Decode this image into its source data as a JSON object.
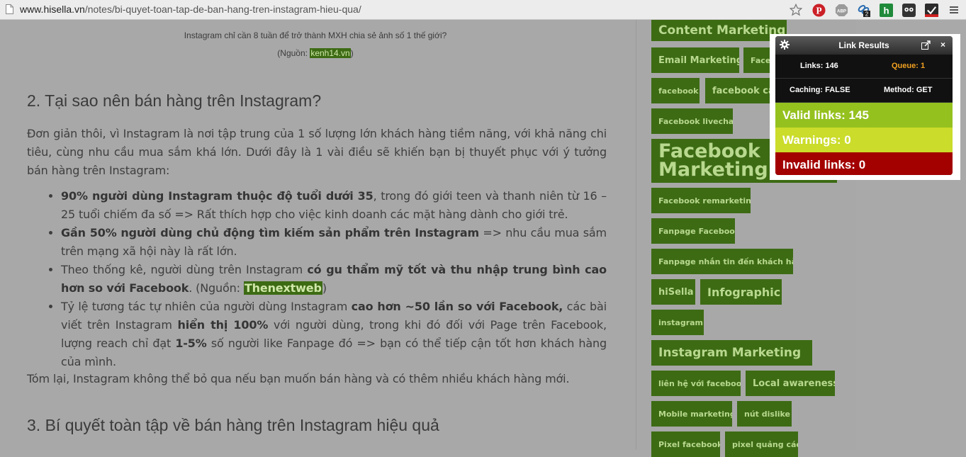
{
  "browser": {
    "url_host": "www.hisella.vn",
    "url_path": "/notes/bi-quyet-toan-tap-de-ban-hang-tren-instagram-hieu-qua/",
    "extensions": [
      "star-icon",
      "pinterest-icon",
      "adblock-icon",
      "link-checker-icon",
      "h-extension-icon",
      "owl-icon",
      "checkmark-icon",
      "menu-icon"
    ],
    "link_badge": "2"
  },
  "article": {
    "caption_line1": "Instagram chỉ cần 8 tuần để trở thành MXH chia sẻ ảnh số 1 thế giới?",
    "caption_source_prefix": "(Nguồn: ",
    "caption_source_link": "kenh14.vn",
    "caption_source_suffix": ")",
    "heading2": "2. Tại sao nên bán hàng trên Instagram?",
    "intro": "Đơn giản thôi, vì Instagram là nơi tập trung của 1 số lượng lớn khách hàng tiềm năng, với khả năng chi tiêu, cùng nhu cầu mua sắm khá lớn. Dưới đây là 1 vài điều sẽ khiến bạn bị thuyết phục với ý tưởng bán hàng trên Instagram:",
    "bullets": [
      {
        "bold": "90% người dùng Instagram thuộc độ tuổi dưới 35",
        "text": ", trong đó giới teen và thanh niên từ 16 – 25 tuổi chiếm đa số => Rất thích hợp cho việc kinh doanh các mặt hàng dành cho giới trẻ."
      },
      {
        "bold": "Gần 50% người dùng chủ động tìm kiếm sản phẩm trên Instagram",
        "text": " => nhu cầu mua sắm trên mạng xã hội này là rất lớn."
      },
      {
        "pre": "Theo thống kê, người dùng trên Instagram ",
        "bold": "có gu thẩm mỹ tốt và thu nhập trung bình cao hơn so với Facebook",
        "mid": ". (Nguồn: ",
        "link": "Thenextweb",
        "post": ")"
      },
      {
        "pre": "Tỷ lệ tương tác tự nhiên của người dùng Instagram ",
        "bold": "cao hơn ~50 lần so với Facebook,",
        "mid": " các bài viết trên Instagram ",
        "bold2": "hiển thị 100%",
        "mid2": " với người dùng, trong khi đó đối với Page trên Facebook, lượng reach chỉ đạt ",
        "bold3": "1-5%",
        "post": " số người like Fanpage đó  => bạn có thể tiếp cận tốt hơn khách hàng của mình."
      }
    ],
    "summary": "Tóm lại, Instagram không thể bỏ qua nếu bạn muốn bán hàng và có thêm nhiều khách hàng mới.",
    "heading3": "3. Bí quyết toàn tập về bán hàng trên Instagram hiệu quả"
  },
  "tags": [
    "Content Marketing",
    "Email Marketing",
    "Facebo",
    "facebook",
    "facebook cập",
    "Facebook livechat",
    "Facebook Marketing",
    "Facebook remarketing",
    "Fanpage Facebook",
    "Fanpage nhắn tin đến khách hàng",
    "hiSella",
    "Infographic",
    "instagram",
    "Instagram Marketing",
    "liên hệ với facebook",
    "Local awareness",
    "Mobile marketing",
    "nút dislike",
    "Pixel facebook",
    "pixel quảng cáo"
  ],
  "link_results": {
    "title": "Link Results",
    "close": "×",
    "links": "Links: 146",
    "queue": "Queue: 1",
    "caching": "Caching: FALSE",
    "method": "Method: GET",
    "valid": "Valid links: 145",
    "warnings": "Warnings: 0",
    "invalid": "Invalid links: 0"
  },
  "colors": {
    "tag_bg": "#3d6b14",
    "tag_text": "#b9d98f",
    "valid": "#95c11f",
    "warnings": "#cbdc2a",
    "invalid": "#a30000",
    "queue_text": "#f0a020"
  }
}
